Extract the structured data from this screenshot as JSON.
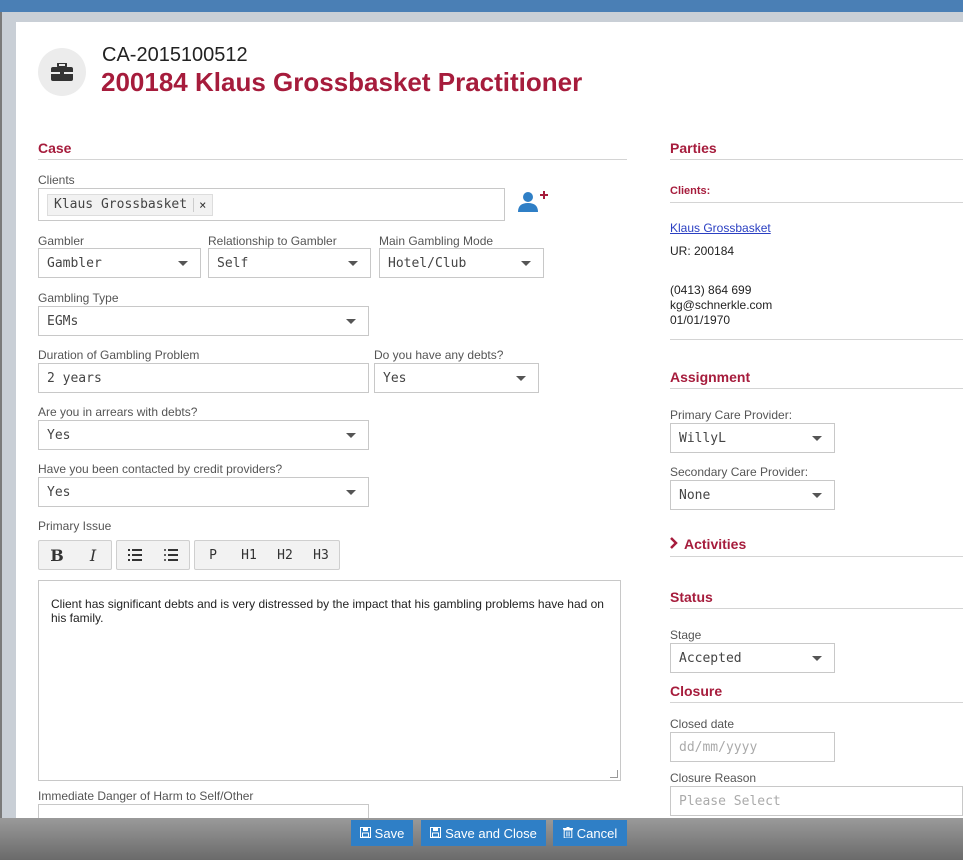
{
  "header": {
    "case_number": "CA-2015100512",
    "title": "200184 Klaus Grossbasket Practitioner",
    "icon": "briefcase-icon"
  },
  "case": {
    "heading": "Case",
    "clients_label": "Clients",
    "client_tag": "Klaus Grossbasket",
    "client_tag_remove": "×",
    "gambler_label": "Gambler",
    "gambler_value": "Gambler",
    "relationship_label": "Relationship to Gambler",
    "relationship_value": "Self",
    "mode_label": "Main Gambling Mode",
    "mode_value": "Hotel/Club",
    "type_label": "Gambling Type",
    "type_value": "EGMs",
    "duration_label": "Duration of Gambling Problem",
    "duration_value": "2 years",
    "debts_label": "Do you have any debts?",
    "debts_value": "Yes",
    "arrears_label": "Are you in arrears with debts?",
    "arrears_value": "Yes",
    "contacted_label": "Have you been contacted by credit providers?",
    "contacted_value": "Yes",
    "primary_issue_label": "Primary Issue",
    "editor_buttons": [
      "B",
      "I",
      "P",
      "H1",
      "H2",
      "H3"
    ],
    "primary_issue_text": "Client has significant debts and is very distressed by the impact that his gambling problems have had on his family.",
    "danger_label": "Immediate Danger of Harm to Self/Other"
  },
  "parties": {
    "heading": "Parties",
    "clients_heading": "Clients:",
    "client_name": "Klaus Grossbasket",
    "ur": "UR: 200184",
    "phone": "(0413) 864 699",
    "email": "kg@schnerkle.com",
    "dob": "01/01/1970"
  },
  "assignment": {
    "heading": "Assignment",
    "primary_label": "Primary Care Provider:",
    "primary_value": "WillyL",
    "secondary_label": "Secondary Care Provider:",
    "secondary_value": "None"
  },
  "activities": {
    "heading": "Activities"
  },
  "status": {
    "heading": "Status",
    "stage_label": "Stage",
    "stage_value": "Accepted"
  },
  "closure": {
    "heading": "Closure",
    "closed_date_label": "Closed date",
    "closed_date_placeholder": "dd/mm/yyyy",
    "reason_label": "Closure Reason",
    "reason_placeholder": "Please Select"
  },
  "footer": {
    "save": "Save",
    "save_close": "Save and Close",
    "cancel": "Cancel"
  },
  "colors": {
    "accent": "#a61c3c",
    "button": "#2f7fc6",
    "link": "#2a3fc2"
  }
}
